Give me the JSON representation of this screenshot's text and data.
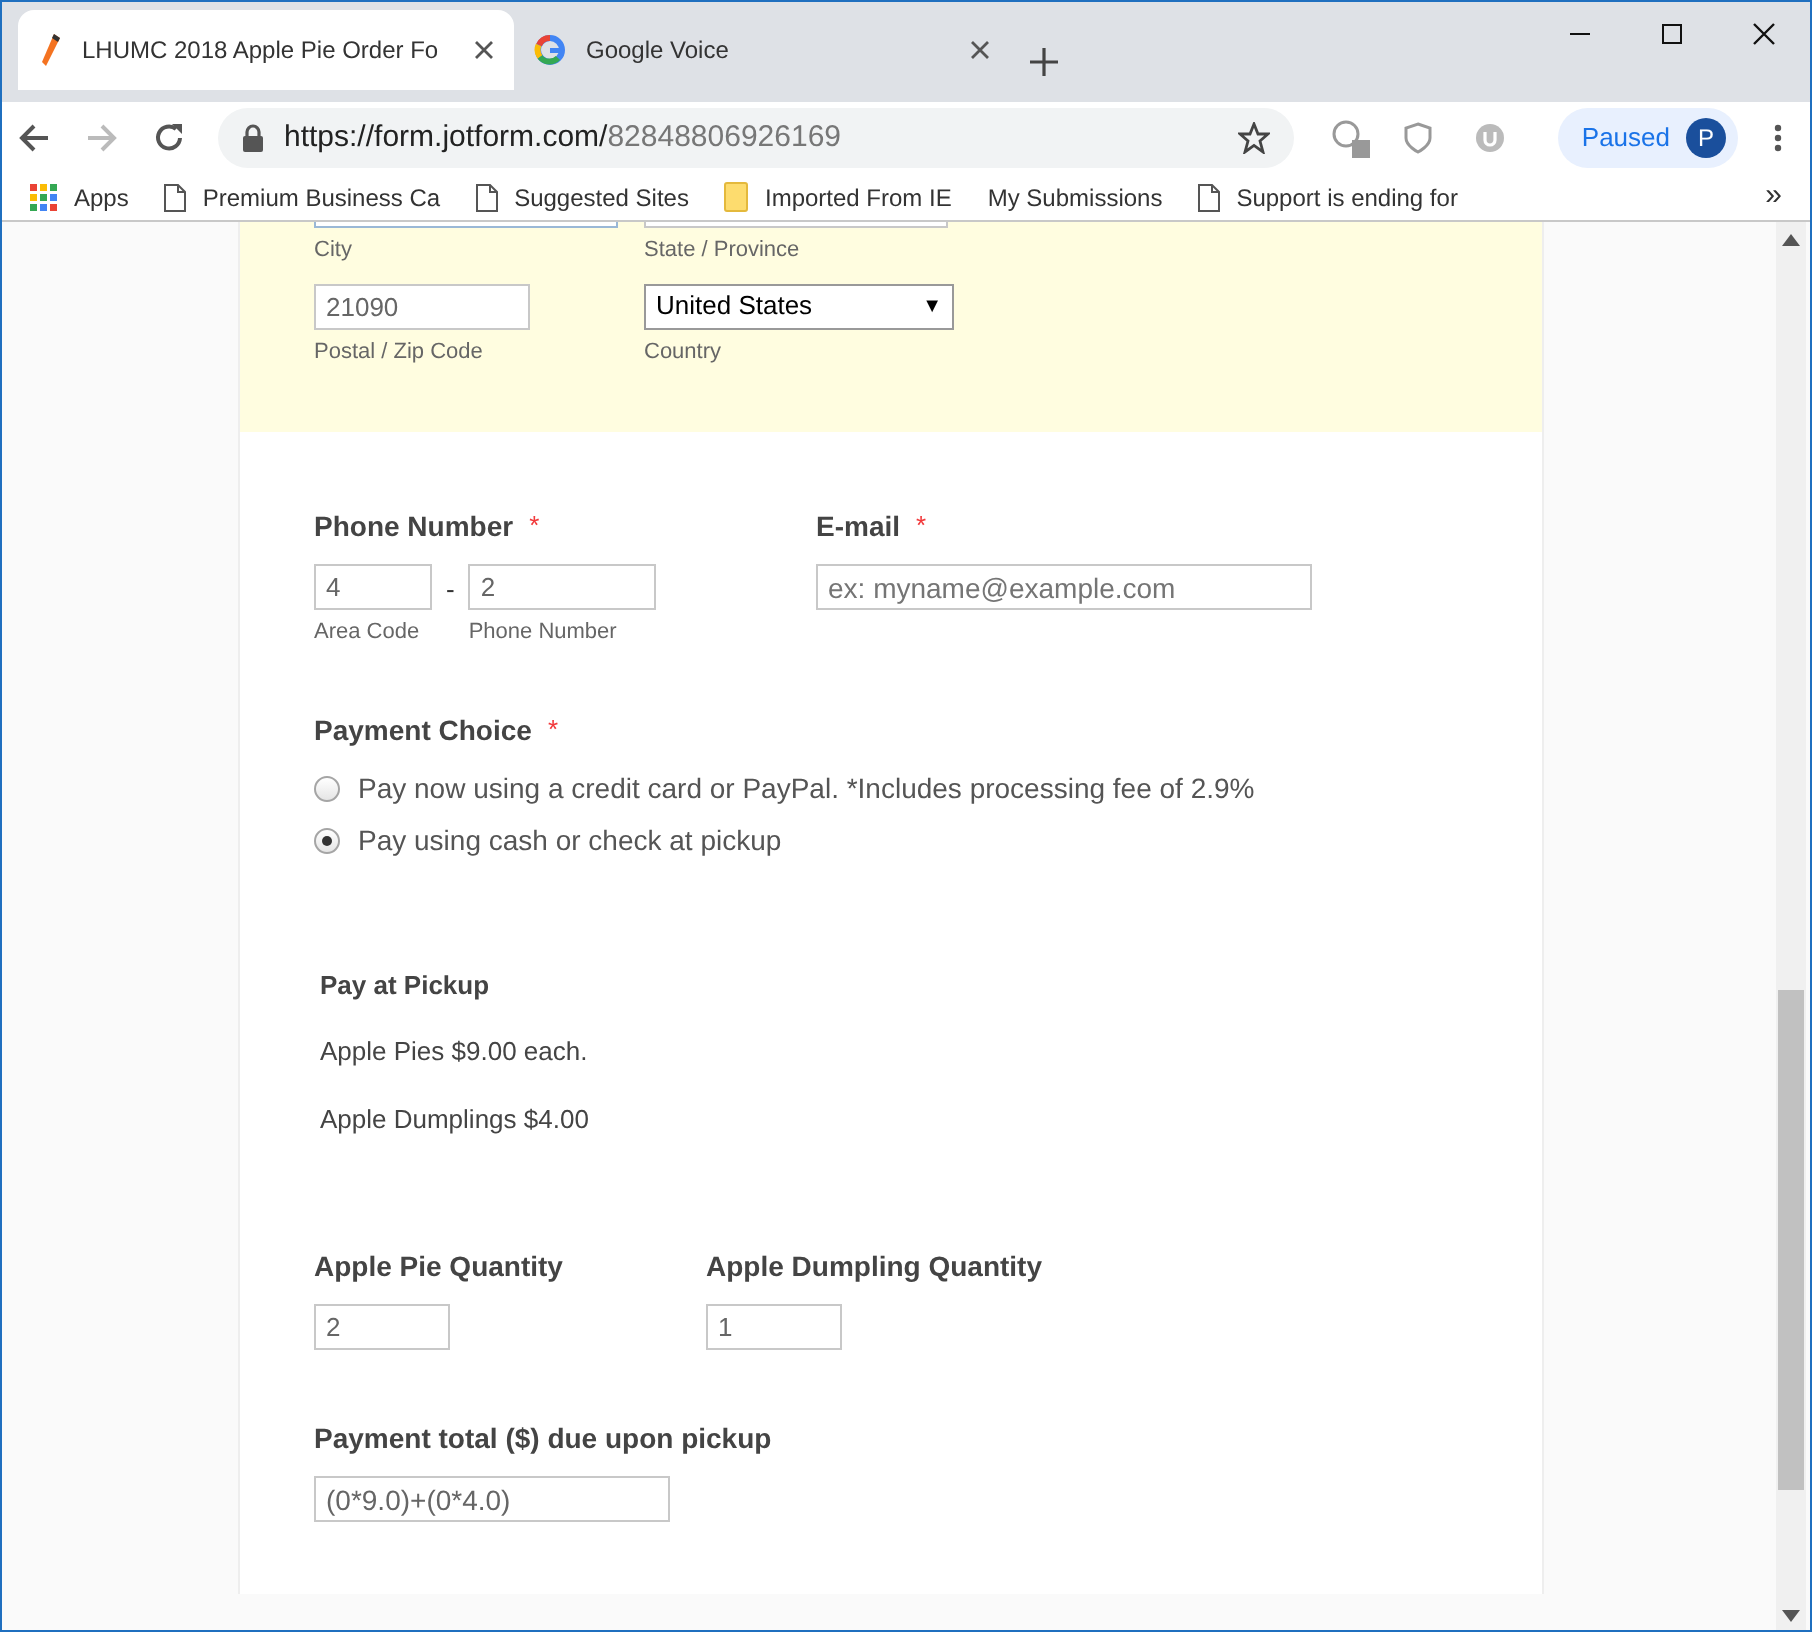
{
  "browser": {
    "tabs": [
      {
        "title": "LHUMC 2018 Apple Pie Order Fo",
        "selected": true
      },
      {
        "title": "Google Voice",
        "selected": false
      }
    ],
    "url_host": "https://form.jotform.com/",
    "url_path": "82848806926169",
    "profile": {
      "label": "Paused",
      "initial": "P"
    },
    "bookmarks": [
      {
        "label": "Apps",
        "kind": "apps"
      },
      {
        "label": "Premium Business Ca",
        "kind": "page"
      },
      {
        "label": "Suggested Sites",
        "kind": "page"
      },
      {
        "label": "Imported From IE",
        "kind": "folder"
      },
      {
        "label": "My Submissions",
        "kind": "none"
      },
      {
        "label": "Support is ending for",
        "kind": "page"
      }
    ],
    "overflow": "»"
  },
  "address": {
    "fields": [
      {
        "label": "City"
      },
      {
        "label": "State / Province"
      }
    ],
    "zip": {
      "label": "Postal / Zip Code",
      "value": "21090"
    },
    "country": {
      "label": "Country",
      "value": "United States",
      "caret": "▼"
    }
  },
  "phone": {
    "label": "Phone Number",
    "required_mark": "*",
    "area": {
      "value": "4",
      "sublabel": "Area Code"
    },
    "dash": "-",
    "number": {
      "value": "2",
      "sublabel": "Phone Number"
    }
  },
  "email": {
    "label": "E-mail",
    "required_mark": "*",
    "placeholder": "ex: myname@example.com"
  },
  "payment_choice": {
    "label": "Payment Choice",
    "required_mark": "*",
    "options": [
      {
        "label": "Pay now using a credit card or PayPal. *Includes processing fee of 2.9%",
        "selected": false
      },
      {
        "label": "Pay using cash or check at pickup",
        "selected": true
      }
    ]
  },
  "pickup_info": {
    "title": "Pay at Pickup",
    "lines": [
      "Apple Pies $9.00 each.",
      "Apple Dumplings $4.00"
    ]
  },
  "quantities": [
    {
      "label": "Apple Pie Quantity",
      "value": "2"
    },
    {
      "label": "Apple Dumpling Quantity",
      "value": "1"
    }
  ],
  "total": {
    "label": "Payment total ($) due upon pickup",
    "value": "(0*9.0)+(0*4.0)"
  }
}
